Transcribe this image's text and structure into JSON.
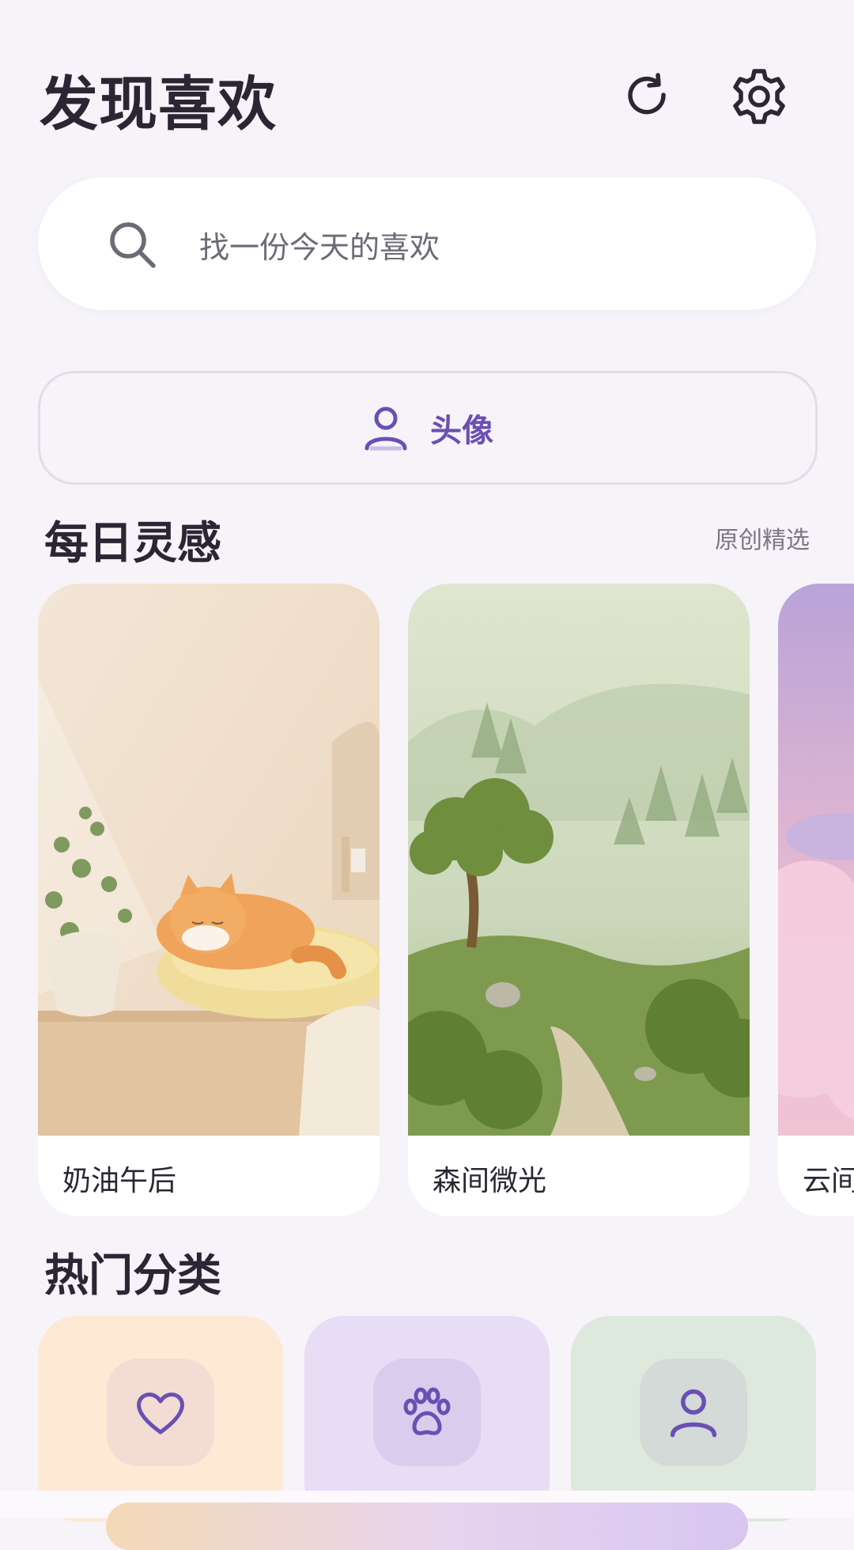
{
  "header": {
    "title": "发现喜欢",
    "refresh_icon": "refresh-icon",
    "settings_icon": "gear-icon"
  },
  "search": {
    "placeholder": "找一份今天的喜欢",
    "icon": "search-icon"
  },
  "avatar_button": {
    "label": "头像",
    "icon": "person-icon"
  },
  "daily": {
    "title": "每日灵感",
    "aside": "原创精选",
    "cards": [
      {
        "caption": "奶油午后"
      },
      {
        "caption": "森间微光"
      },
      {
        "caption": "云间"
      }
    ]
  },
  "hot": {
    "title": "热门分类",
    "categories": [
      {
        "icon": "heart-icon",
        "bg": "#fde9d4"
      },
      {
        "icon": "paw-icon",
        "bg": "#e7ddf5"
      },
      {
        "icon": "person-icon",
        "bg": "#dde9dc"
      }
    ]
  },
  "colors": {
    "accent": "#6a4fb3",
    "background": "#f6f3f9"
  }
}
